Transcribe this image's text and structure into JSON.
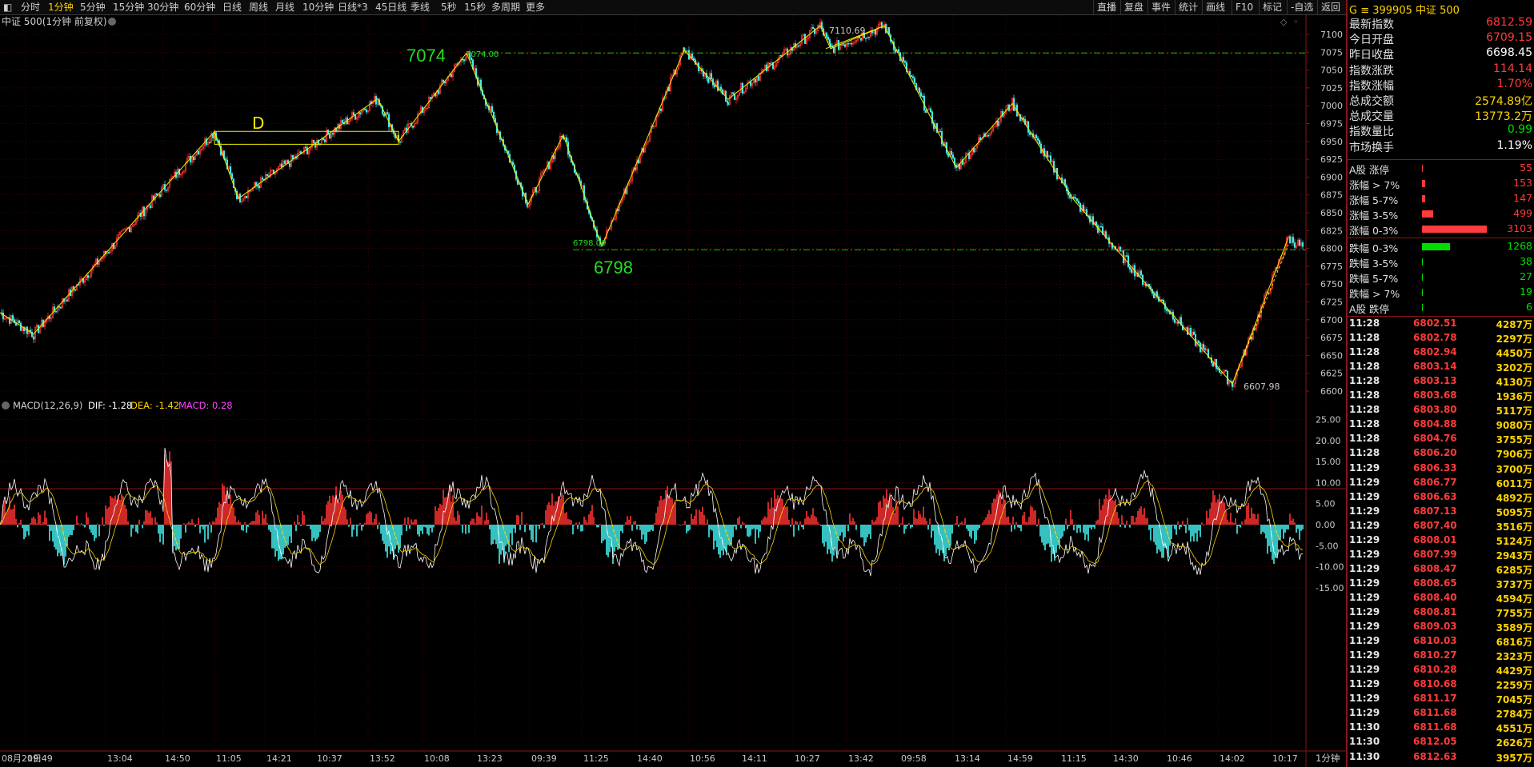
{
  "toolbar": {
    "periods": [
      "分时",
      "1分钟",
      "5分钟",
      "15分钟",
      "30分钟",
      "60分钟",
      "日线",
      "周线",
      "月线",
      "10分钟",
      "日线*3",
      "45日线",
      "季线",
      "5秒",
      "15秒",
      "多周期",
      "更多"
    ],
    "active_period": "1分钟",
    "right_items": [
      "直播",
      "复盘",
      "事件",
      "统计",
      "画线",
      "F10",
      "标记",
      "-自选",
      "返回"
    ]
  },
  "main_chart": {
    "title": "中证 500(1分钟 前复权)",
    "price_ticks": [
      "7100",
      "7075",
      "7050",
      "7025",
      "7000",
      "6975",
      "6950",
      "6925",
      "6900",
      "6875",
      "6850",
      "6825",
      "6800",
      "6775",
      "6750",
      "6725",
      "6700",
      "6675",
      "6650",
      "6625",
      "6600"
    ],
    "annotations": {
      "big_high": "7074",
      "small_high": "7074.00",
      "big_low": "6798",
      "small_low": "6798.00",
      "peak": "7110.69",
      "trough": "6607.98",
      "pattern_label": "D"
    },
    "colors": {
      "grid": "#7a0000",
      "up": "#ff3333",
      "down": "#44f0f0",
      "pattern_line": "#f0f000",
      "ref_line": "#00cc00"
    }
  },
  "macd": {
    "name": "MACD(12,26,9)",
    "dif_label": "DIF: -1.28",
    "dea_label": "DEA: -1.42",
    "macd_label": "MACD: 0.28",
    "ticks": [
      "25.00",
      "20.00",
      "15.00",
      "10.00",
      "5.00",
      "0.00",
      "-5.00",
      "-10.00",
      "-15.00"
    ]
  },
  "time_axis": {
    "labels": [
      "08月21日",
      "09:49",
      "13:04",
      "14:50",
      "11:05",
      "14:21",
      "10:37",
      "13:52",
      "10:08",
      "13:23",
      "09:39",
      "11:25",
      "14:40",
      "10:56",
      "14:11",
      "10:27",
      "13:42",
      "09:58",
      "13:14",
      "14:59",
      "11:15",
      "14:30",
      "10:46",
      "14:02",
      "10:17"
    ],
    "period_label": "1分钟"
  },
  "quote_panel": {
    "code_header": "G ≡ 399905 中证 500",
    "rows": [
      {
        "label": "最新指数",
        "value": "6812.59",
        "color": "red"
      },
      {
        "label": "今日开盘",
        "value": "6709.15",
        "color": "red"
      },
      {
        "label": "昨日收盘",
        "value": "6698.45",
        "color": "white"
      },
      {
        "label": "指数涨跌",
        "value": "114.14",
        "color": "red"
      },
      {
        "label": "指数涨幅",
        "value": "1.70%",
        "color": "red"
      },
      {
        "label": "总成交额",
        "value": "2574.89亿",
        "color": "yellow"
      },
      {
        "label": "总成交量",
        "value": "13773.2万",
        "color": "yellow"
      },
      {
        "label": "指数量比",
        "value": "0.99",
        "color": "green"
      },
      {
        "label": "市场换手",
        "value": "1.19%",
        "color": "white"
      }
    ],
    "breadth_up": [
      {
        "label": "A股 涨停",
        "value": "55",
        "pct": 0.5
      },
      {
        "label": "涨幅 > 7%",
        "value": "153",
        "pct": 3
      },
      {
        "label": "涨幅 5-7%",
        "value": "147",
        "pct": 3
      },
      {
        "label": "涨幅 3-5%",
        "value": "499",
        "pct": 10
      },
      {
        "label": "涨幅 0-3%",
        "value": "3103",
        "pct": 58
      }
    ],
    "breadth_down": [
      {
        "label": "跌幅 0-3%",
        "value": "1268",
        "pct": 25
      },
      {
        "label": "跌幅 3-5%",
        "value": "38",
        "pct": 0.5
      },
      {
        "label": "跌幅 5-7%",
        "value": "27",
        "pct": 0.5
      },
      {
        "label": "跌幅 > 7%",
        "value": "19",
        "pct": 0.5
      },
      {
        "label": "A股 跌停",
        "value": "6",
        "pct": 0.3
      }
    ],
    "ticks": [
      {
        "time": "11:28",
        "price": "6802.51",
        "vol": "4287万"
      },
      {
        "time": "11:28",
        "price": "6802.78",
        "vol": "2297万"
      },
      {
        "time": "11:28",
        "price": "6802.94",
        "vol": "4450万"
      },
      {
        "time": "11:28",
        "price": "6803.14",
        "vol": "3202万"
      },
      {
        "time": "11:28",
        "price": "6803.13",
        "vol": "4130万"
      },
      {
        "time": "11:28",
        "price": "6803.68",
        "vol": "1936万"
      },
      {
        "time": "11:28",
        "price": "6803.80",
        "vol": "5117万"
      },
      {
        "time": "11:28",
        "price": "6804.88",
        "vol": "9080万"
      },
      {
        "time": "11:28",
        "price": "6804.76",
        "vol": "3755万"
      },
      {
        "time": "11:28",
        "price": "6806.20",
        "vol": "7906万"
      },
      {
        "time": "11:29",
        "price": "6806.33",
        "vol": "3700万"
      },
      {
        "time": "11:29",
        "price": "6806.77",
        "vol": "6011万"
      },
      {
        "time": "11:29",
        "price": "6806.63",
        "vol": "4892万"
      },
      {
        "time": "11:29",
        "price": "6807.13",
        "vol": "5095万"
      },
      {
        "time": "11:29",
        "price": "6807.40",
        "vol": "3516万"
      },
      {
        "time": "11:29",
        "price": "6808.01",
        "vol": "5124万"
      },
      {
        "time": "11:29",
        "price": "6807.99",
        "vol": "2943万"
      },
      {
        "time": "11:29",
        "price": "6808.47",
        "vol": "6285万"
      },
      {
        "time": "11:29",
        "price": "6808.65",
        "vol": "3737万"
      },
      {
        "time": "11:29",
        "price": "6808.40",
        "vol": "4594万"
      },
      {
        "time": "11:29",
        "price": "6808.81",
        "vol": "7755万"
      },
      {
        "time": "11:29",
        "price": "6809.03",
        "vol": "3589万"
      },
      {
        "time": "11:29",
        "price": "6810.03",
        "vol": "6816万"
      },
      {
        "time": "11:29",
        "price": "6810.27",
        "vol": "2323万"
      },
      {
        "time": "11:29",
        "price": "6810.28",
        "vol": "4429万"
      },
      {
        "time": "11:29",
        "price": "6810.68",
        "vol": "2259万"
      },
      {
        "time": "11:29",
        "price": "6811.17",
        "vol": "7045万"
      },
      {
        "time": "11:29",
        "price": "6811.68",
        "vol": "2784万"
      },
      {
        "time": "11:30",
        "price": "6811.68",
        "vol": "4551万"
      },
      {
        "time": "11:30",
        "price": "6812.05",
        "vol": "2626万"
      },
      {
        "time": "11:30",
        "price": "6812.63",
        "vol": "3957万"
      }
    ]
  }
}
